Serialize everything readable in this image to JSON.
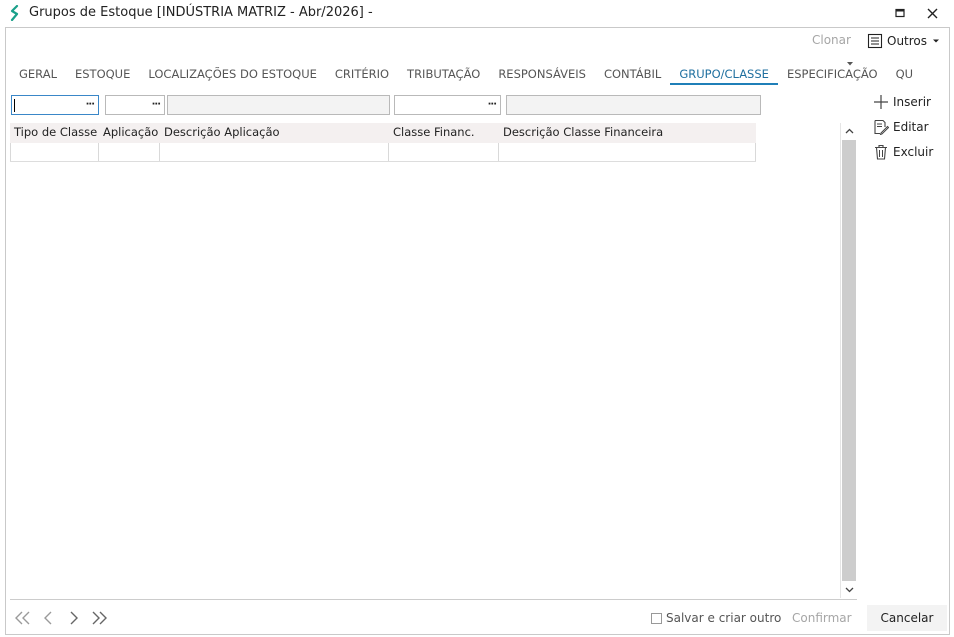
{
  "window": {
    "title": "Grupos de Estoque [INDÚSTRIA MATRIZ - Abr/2026]  -"
  },
  "toolbar": {
    "clonar": "Clonar",
    "outros": "Outros"
  },
  "tabs": [
    {
      "label": "GERAL",
      "active": false
    },
    {
      "label": "ESTOQUE",
      "active": false
    },
    {
      "label": "LOCALIZAÇÕES DO ESTOQUE",
      "active": false
    },
    {
      "label": "CRITÉRIO",
      "active": false
    },
    {
      "label": "TRIBUTAÇÃO",
      "active": false
    },
    {
      "label": "RESPONSÁVEIS",
      "active": false
    },
    {
      "label": "CONTÁBIL",
      "active": false
    },
    {
      "label": "GRUPO/CLASSE",
      "active": true
    },
    {
      "label": "ESPECIFICAÇÃO",
      "active": false
    },
    {
      "label": "QU",
      "active": false
    }
  ],
  "filters": {
    "dots": "···"
  },
  "grid": {
    "columns": [
      "Tipo de Classe",
      "Aplicação",
      "Descrição Aplicação",
      "Classe Financ.",
      "Descrição Classe Financeira"
    ],
    "rows": [
      [
        "",
        "",
        "",
        "",
        ""
      ]
    ]
  },
  "actions": {
    "inserir": "Inserir",
    "editar": "Editar",
    "excluir": "Excluir"
  },
  "footer": {
    "salvar": "Salvar e criar outro",
    "confirmar": "Confirmar",
    "cancelar": "Cancelar"
  },
  "colors": {
    "accent": "#1f7fb8",
    "disabled": "#a6a6a6",
    "logo": "#1aa08a"
  }
}
